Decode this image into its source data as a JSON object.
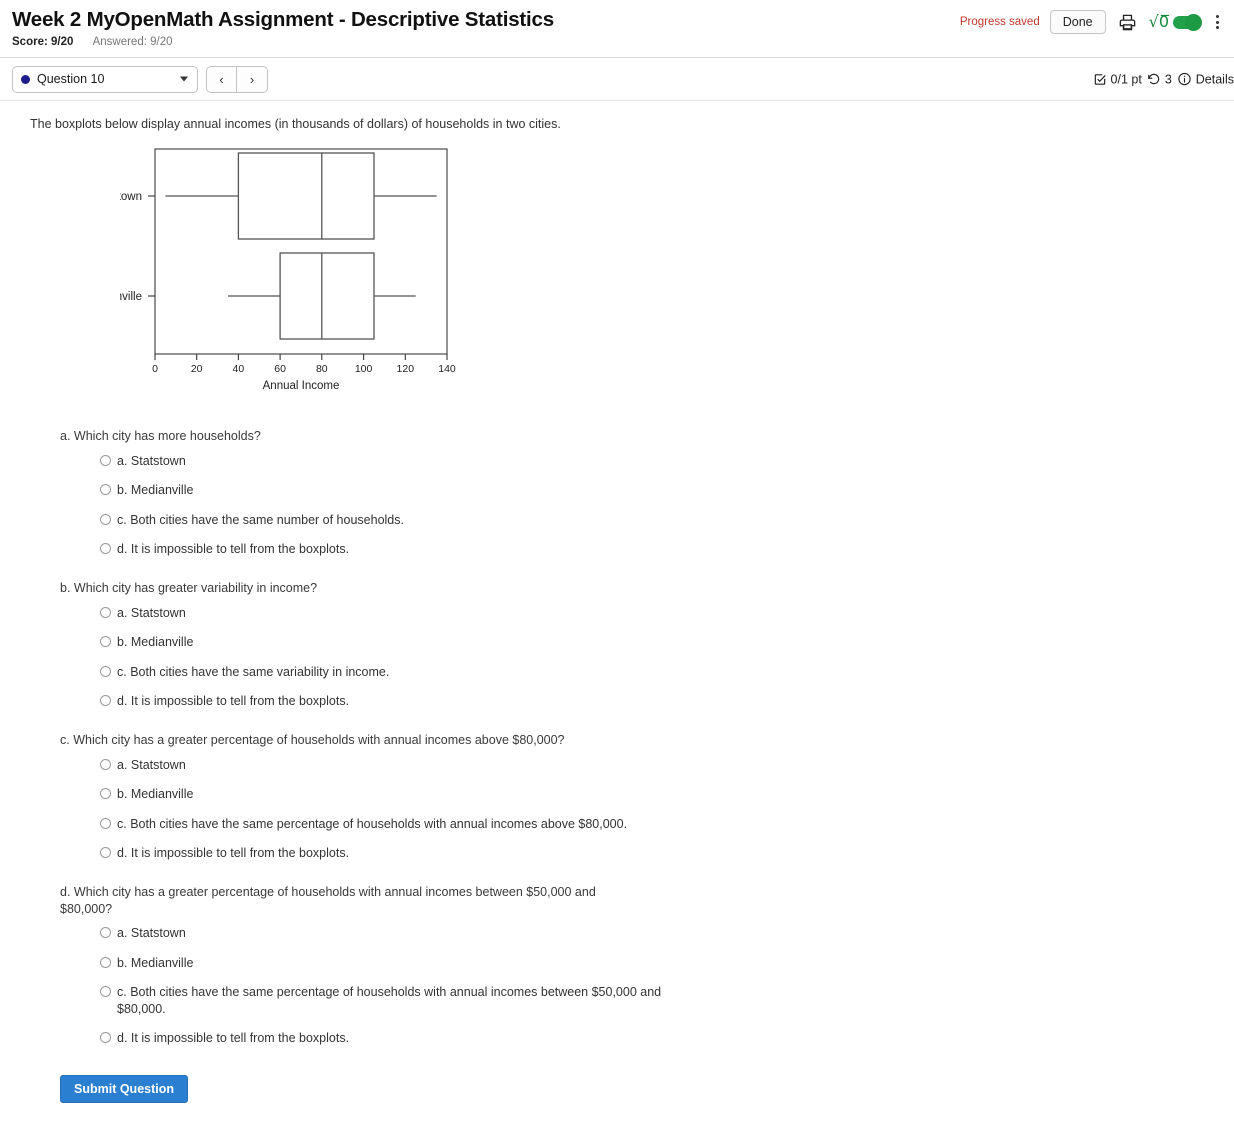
{
  "header": {
    "title": "Week 2 MyOpenMath Assignment - Descriptive Statistics",
    "score_label": "Score: 9/20",
    "answered_label": "Answered: 9/20",
    "progress_saved": "Progress saved",
    "done_label": "Done",
    "print_icon": "printer-icon",
    "math_toggle_icon": "square-root-icon",
    "menu_icon": "kebab-menu-icon"
  },
  "question_bar": {
    "question_selector": "Question 10",
    "prev_label": "‹",
    "next_label": "›",
    "points": "0/1 pt",
    "attempts": "3",
    "details_label": "Details",
    "points_icon": "checkbox-icon",
    "attempts_icon": "retry-icon",
    "details_icon": "info-icon"
  },
  "question": {
    "prompt": "The boxplots below display annual incomes (in thousands of dollars) of households in two cities.",
    "parts": [
      {
        "label": "a.",
        "text": "Which city has more households?",
        "options": [
          "a. Statstown",
          "b. Medianville",
          "c. Both cities have the same number of households.",
          "d. It is impossible to tell from the boxplots."
        ]
      },
      {
        "label": "b.",
        "text": "Which city has greater variability in income?",
        "options": [
          "a. Statstown",
          "b. Medianville",
          "c. Both cities have the same variability in income.",
          "d. It is impossible to tell from the boxplots."
        ]
      },
      {
        "label": "c.",
        "text": "Which city has a greater percentage of households with annual incomes above $80,000?",
        "options": [
          "a. Statstown",
          "b. Medianville",
          "c. Both cities have the same percentage of households with annual incomes above $80,000.",
          "d. It is impossible to tell from the boxplots."
        ]
      },
      {
        "label": "d.",
        "text": "Which city has a greater percentage of households with annual incomes between $50,000 and $80,000?",
        "options": [
          "a. Statstown",
          "b. Medianville",
          "c. Both cities have the same percentage of households with annual incomes between $50,000 and $80,000.",
          "d. It is impossible to tell from the boxplots."
        ]
      }
    ],
    "submit_label": "Submit Question"
  },
  "chart_data": {
    "type": "boxplot",
    "title": "",
    "xlabel": "Annual Income",
    "ylabel": "",
    "xlim": [
      0,
      140
    ],
    "xticks": [
      0,
      20,
      40,
      60,
      80,
      100,
      120,
      140
    ],
    "categories": [
      "Statstown",
      "Medianville"
    ],
    "grid": false,
    "legend": "none",
    "series": [
      {
        "name": "Statstown",
        "min": 5,
        "q1": 40,
        "median": 80,
        "q3": 105,
        "max": 135
      },
      {
        "name": "Medianville",
        "min": 35,
        "q1": 60,
        "median": 80,
        "q3": 105,
        "max": 125
      }
    ]
  },
  "colors": {
    "accent": "#2a7fd0",
    "progress_saved": "#c0392b",
    "toggle_on": "#22a04a",
    "question_dot": "#1d1d8c"
  }
}
